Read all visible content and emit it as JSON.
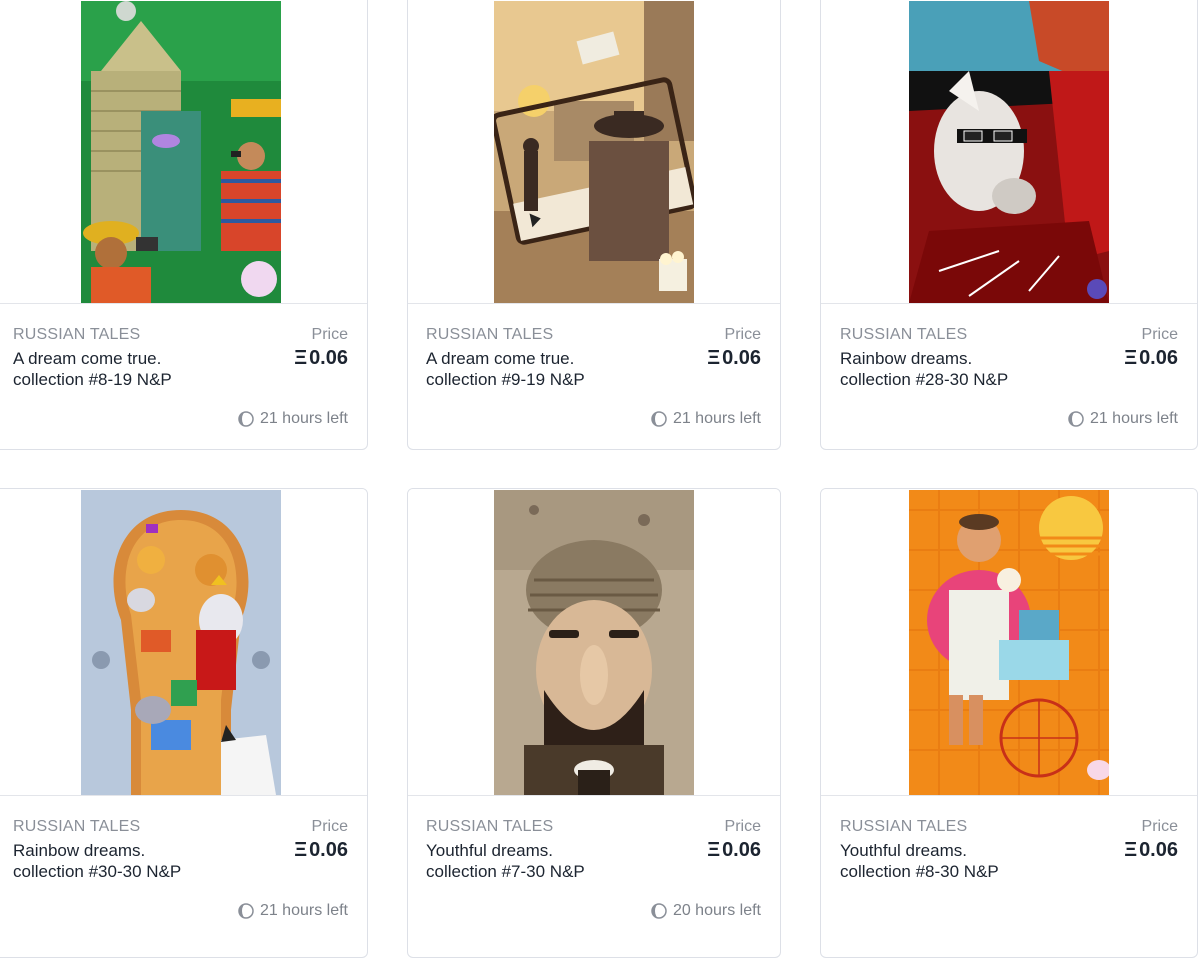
{
  "cards": [
    {
      "brand": "RUSSIAN TALES",
      "title_line1": "A dream come true.",
      "title_line2": "collection #8-19 N&P",
      "price_label": "Price",
      "currency_symbol": "Ξ",
      "price": "0.06",
      "time_left": "21 hours left",
      "art": "jungle-pyramid-tourists-illustration"
    },
    {
      "brand": "RUSSIAN TALES",
      "title_line1": "A dream come true.",
      "title_line2": "collection #9-19 N&P",
      "price_label": "Price",
      "currency_symbol": "Ξ",
      "price": "0.06",
      "time_left": "21 hours left",
      "art": "western-cowboy-video-player-illustration"
    },
    {
      "brand": "RUSSIAN TALES",
      "title_line1": "Rainbow dreams.",
      "title_line2": "collection #28-30 N&P",
      "price_label": "Price",
      "currency_symbol": "Ξ",
      "price": "0.06",
      "time_left": "21 hours left",
      "art": "dog-in-red-car-sunglasses-illustration"
    },
    {
      "brand": "RUSSIAN TALES",
      "title_line1": "Rainbow dreams.",
      "title_line2": "collection #30-30 N&P",
      "price_label": "Price",
      "currency_symbol": "Ξ",
      "price": "0.06",
      "time_left": "21 hours left",
      "art": "keyhole-mice-christmas-illustration"
    },
    {
      "brand": "RUSSIAN TALES",
      "title_line1": "Youthful dreams.",
      "title_line2": "collection #7-30 N&P",
      "price_label": "Price",
      "currency_symbol": "Ξ",
      "price": "0.06",
      "time_left": "20 hours left",
      "art": "bearded-man-beanie-illustration"
    },
    {
      "brand": "RUSSIAN TALES",
      "title_line1": "Youthful dreams.",
      "title_line2": "collection #8-30 N&P",
      "price_label": "Price",
      "currency_symbol": "Ξ",
      "price": "0.06",
      "time_left": "",
      "art": "ice-cream-vendor-illustration"
    }
  ],
  "colors": {
    "card_border": "#dde0e7",
    "muted_text": "#8a8f98",
    "primary_text": "#1c2430"
  },
  "icons": {
    "timer": "half-moon-clock-icon",
    "currency": "ethereum-symbol"
  }
}
